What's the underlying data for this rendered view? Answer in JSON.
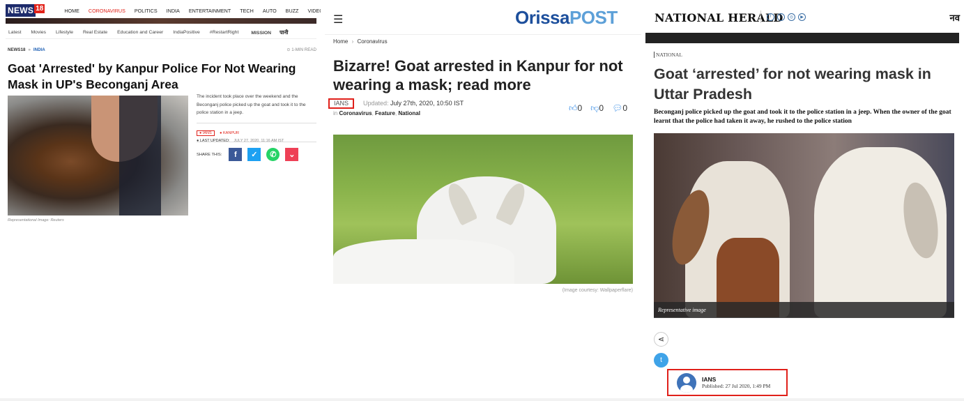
{
  "news18": {
    "logo_text": "NEWS",
    "logo_num": "18",
    "nav": [
      "HOME",
      "CORONAVIRUS",
      "POLITICS",
      "INDIA",
      "ENTERTAINMENT",
      "TECH",
      "AUTO",
      "BUZZ",
      "VIDEOS"
    ],
    "nav_active": "CORONAVIRUS",
    "subnav": [
      "Latest",
      "Movies",
      "Lifestyle",
      "Real Estate",
      "Education and Career",
      "IndiaPositive",
      "#RestartRight"
    ],
    "mission_label": "MISSION",
    "mission_hindi": "पानी",
    "crumb_home": "NEWS18",
    "crumb_section": "INDIA",
    "read_time": "1-MIN READ",
    "title": "Goat 'Arrested' by Kanpur Police For Not Wearing Mask in UP's Beconganj Area",
    "lead": "The incident took place over the weekend and the Beconganj police picked up the goat and took it to the police station in a jeep.",
    "source": "IANS",
    "location": "KANPUR",
    "last_updated_label": "LAST UPDATED:",
    "last_updated": "JULY 27, 2020, 11:16 AM IST",
    "share_label": "SHARE THIS:",
    "image_caption": "Representational Image: Reuters",
    "colors": {
      "brand_red": "#e2231a",
      "brand_blue": "#1d2b6b"
    }
  },
  "orissapost": {
    "logo_main": "Orissa",
    "logo_post": "POST",
    "breadcrumb": [
      "Home",
      "Coronavirus"
    ],
    "title": "Bizarre! Goat arrested in Kanpur for not wearing a mask; read more",
    "source": "IANS",
    "updated_label": "Updated:",
    "updated": "July 27th, 2020, 10:50 IST",
    "in_label": "in",
    "categories": [
      "Coronavirus",
      "Feature",
      "National"
    ],
    "likes": "0",
    "dislikes": "0",
    "comments": "0",
    "image_caption": "(Image courtesy: Wallpaperflare)",
    "colors": {
      "logo_dark": "#1d4f9c",
      "logo_light": "#5da0d8"
    }
  },
  "national_herald": {
    "logo": "NATIONAL HERALD",
    "hindi_logo": "नव",
    "category": "NATIONAL",
    "title": "Goat ‘arrested’ for not wearing mask in Uttar Pradesh",
    "lead": "Beconganj police picked up the goat and took it to the police station in a jeep. When the owner of the goat learnt that the police had taken it away, he rushed to the police station",
    "image_caption": "Representative image",
    "author": "IANS",
    "published": "Published: 27 Jul 2020, 1:49 PM",
    "colors": {
      "highlight": "#e0201a",
      "twitter": "#3fa3e8"
    }
  }
}
